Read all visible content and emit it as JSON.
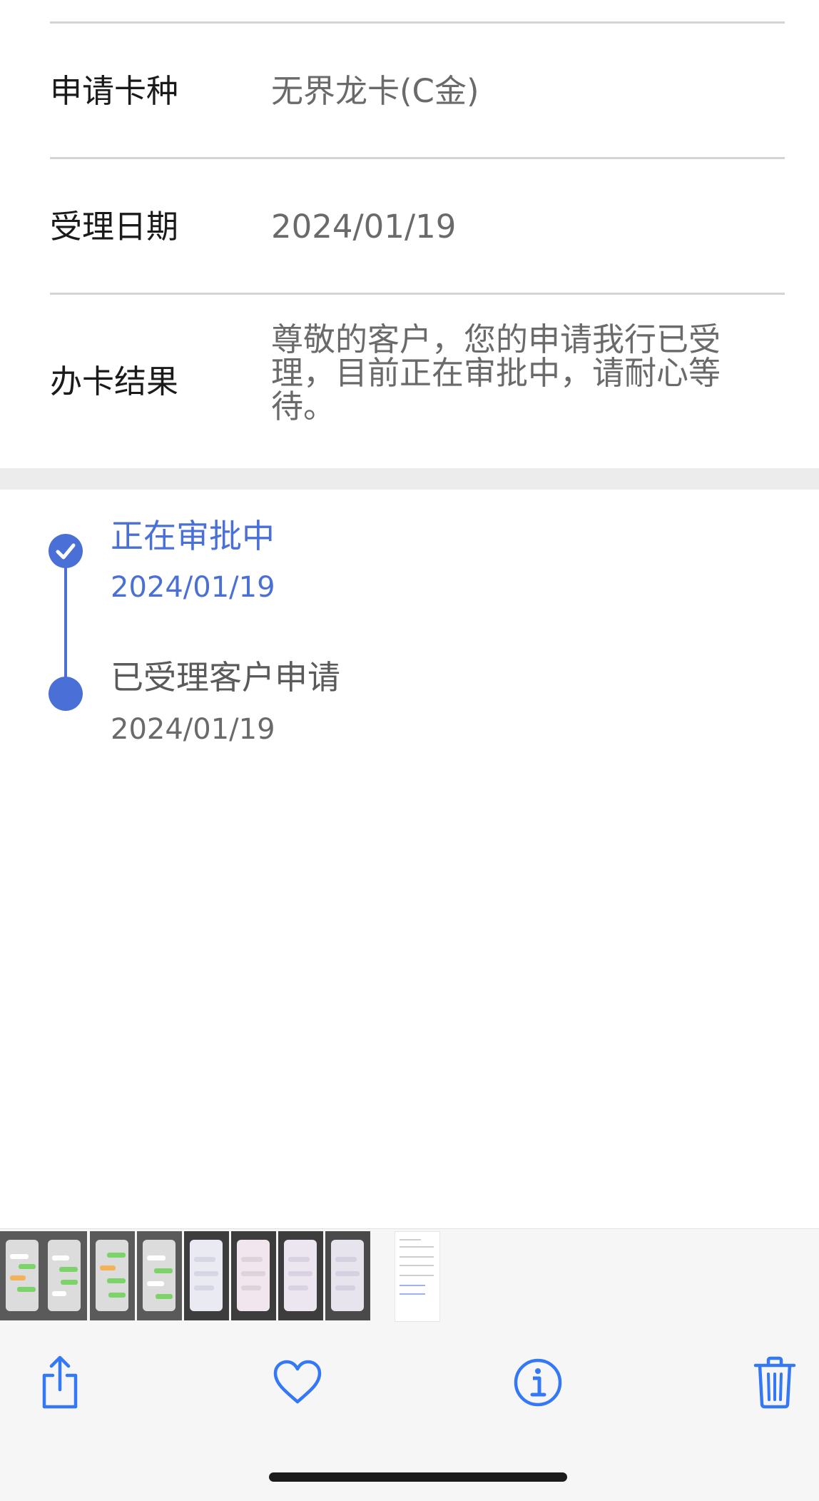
{
  "info": {
    "rows": [
      {
        "label": "申请卡种",
        "value": "无界龙卡(C金)"
      },
      {
        "label": "受理日期",
        "value": "2024/01/19"
      },
      {
        "label": "办卡结果",
        "value": "尊敬的客户，您的申请我行已受理，目前正在审批中，请耐心等待。"
      }
    ]
  },
  "timeline": {
    "steps": [
      {
        "title": "正在审批中",
        "date": "2024/01/19",
        "state": "current",
        "icon": "check-circle-icon"
      },
      {
        "title": "已受理客户申请",
        "date": "2024/01/19",
        "state": "done",
        "icon": "dot-icon"
      }
    ]
  },
  "colors": {
    "accent": "#4a6fd6",
    "label": "#1a1a1a",
    "value": "#6a6a6a",
    "ios_blue": "#3478f6"
  },
  "toolbar": {
    "icons": [
      "share-icon",
      "heart-icon",
      "info-icon",
      "trash-icon"
    ]
  }
}
